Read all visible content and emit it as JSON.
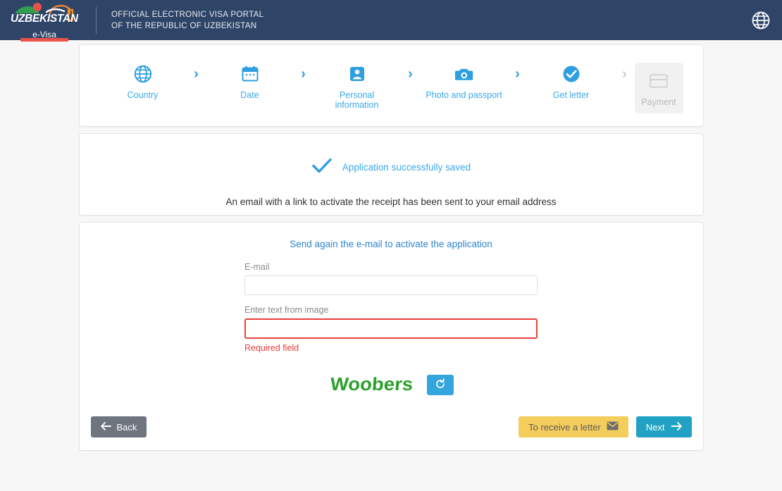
{
  "header": {
    "logo_main": "UZBEKISTAN",
    "logo_sub": "e-Visa",
    "title_line1": "OFFICIAL ELECTRONIC VISA PORTAL",
    "title_line2": "OF THE REPUBLIC OF UZBEKISTAN",
    "language_icon": "globe-icon",
    "bg_color": "#2f4568",
    "accent_red": "#e8524a"
  },
  "stepper": {
    "separator": "›",
    "steps": [
      {
        "label": "Country",
        "icon": "globe-icon",
        "state": "active"
      },
      {
        "label": "Date",
        "icon": "calendar-icon",
        "state": "active"
      },
      {
        "label": "Personal\ninformation",
        "label_line1": "Personal",
        "label_line2": "information",
        "icon": "person-card-icon",
        "state": "active"
      },
      {
        "label": "Photo and passport",
        "icon": "camera-icon",
        "state": "active"
      },
      {
        "label": "Get letter",
        "icon": "check-circle-icon",
        "state": "active"
      },
      {
        "label": "Payment",
        "icon": "credit-card-icon",
        "state": "disabled"
      }
    ],
    "active_color": "#3aa8e8",
    "disabled_color": "#b9b9b9"
  },
  "success": {
    "icon": "checkmark-icon",
    "title": "Application successfully saved",
    "message": "An email with a link to activate the receipt has been sent to your email address"
  },
  "form": {
    "title_link": "Send again the e-mail to activate the application",
    "email": {
      "label": "E-mail",
      "value": "",
      "placeholder": ""
    },
    "captcha_field": {
      "label": "Enter text from image",
      "value": "",
      "placeholder": "",
      "error": "Required field"
    },
    "captcha": {
      "text": "Woobers",
      "color": "#2ca02c",
      "refresh_icon": "refresh-icon"
    }
  },
  "footer": {
    "back_label": "Back",
    "back_icon": "arrow-left-icon",
    "letter_label": "To receive a letter",
    "letter_icon": "envelope-icon",
    "next_label": "Next",
    "next_icon": "arrow-right-icon"
  }
}
